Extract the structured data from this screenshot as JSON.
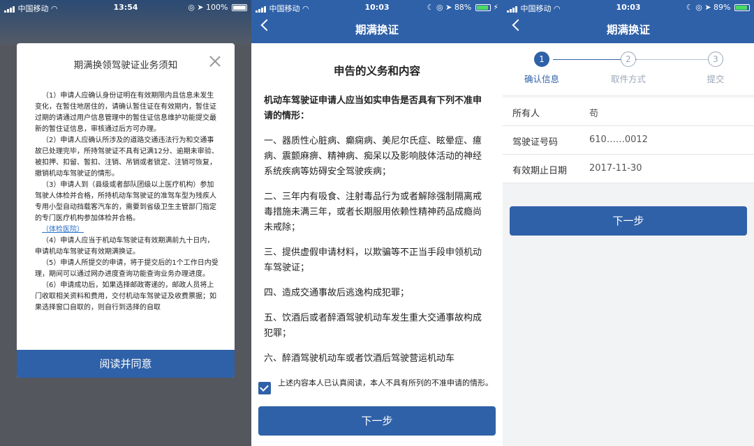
{
  "panel1": {
    "status": {
      "carrier": "中国移动",
      "time": "13:54",
      "battery": "100%"
    },
    "modal": {
      "title": "期满换领驾驶证业务须知",
      "items": [
        "（1）申请人应确认身份证明在有效期限内且信息未发生变化，在暂住地居住的，请确认暂住证在有效期内，暂住证过期的请通过用户信息管理中的暂住证信息维护功能提交最新的暂住证信息，审核通过后方可办理。",
        "（2）申请人应确认所涉及的道路交通违法行为和交通事故已处理完毕，所持驾驶证不具有记满12分、逾期未审验、被扣押、扣留、暂扣、注销、吊销或者锁定、注销可恢复，撤销机动车驾驶证的情形。",
        "（3）申请人到（县级或者部队团级以上医疗机构）参加驾驶人体检并合格，所持机动车驾驶证的准驾车型为残疾人专用小型自动挡载客汽车的，需要到省级卫生主管部门指定的专门医疗机构参加体检并合格。",
        "（4）申请人应当于机动车驾驶证有效期满前九十日内，申请机动车驾驶证有效期满换证。",
        "（5）申请人所提交的申请，将于提交后的1个工作日内受理，期间可以通过网办进度查询功能查询业务办理进度。",
        "（6）申请成功后，如果选择邮政寄递的，邮政人员将上门收取相关资料和费用，交付机动车驾驶证及收费票据；如果选择窗口自取的，则自行到选择的自取"
      ],
      "hospital_link": "（体检医院）",
      "confirm_button": "阅读并同意"
    }
  },
  "panel2": {
    "status": {
      "carrier": "中国移动",
      "time": "10:03",
      "battery": "88%"
    },
    "nav_title": "期满换证",
    "heading": "申告的义务和内容",
    "intro": "机动车驾驶证申请人应当如实申告是否具有下列不准申请的情形：",
    "items": [
      "一、器质性心脏病、癫痫病、美尼尔氏症、眩晕症、癔病、震颤麻痹、精神病、痴呆以及影响肢体活动的神经系统疾病等妨碍安全驾驶疾病；",
      "二、三年内有吸食、注射毒品行为或者解除强制隔离戒毒措施未满三年，或者长期服用依赖性精神药品成瘾尚未戒除；",
      "三、提供虚假申请材料，以欺骗等不正当手段申领机动车驾驶证；",
      "四、造成交通事故后逃逸构成犯罪；",
      "五、饮酒后或者醉酒驾驶机动车发生重大交通事故构成犯罪；",
      "六、醉酒驾驶机动车或者饮酒后驾驶营运机动车"
    ],
    "agree_text": "上述内容本人已认真阅读，本人不具有所列的不准申请的情形。",
    "agree_checked": true,
    "next_button": "下一步"
  },
  "panel3": {
    "status": {
      "carrier": "中国移动",
      "time": "10:03",
      "battery": "89%"
    },
    "nav_title": "期满换证",
    "steps": [
      {
        "num": "1",
        "label": "确认信息"
      },
      {
        "num": "2",
        "label": "取件方式"
      },
      {
        "num": "3",
        "label": "提交"
      }
    ],
    "active_step": 1,
    "fields": {
      "owner_label": "所有人",
      "owner_value": "苟",
      "license_label": "驾驶证号码",
      "license_value": "610……0012",
      "expiry_label": "有效期止日期",
      "expiry_value": "2017-11-30"
    },
    "next_button": "下一步"
  },
  "colors": {
    "primary": "#2f61a8",
    "inactive": "#9aa7b8",
    "battery_green": "#4cd964"
  }
}
